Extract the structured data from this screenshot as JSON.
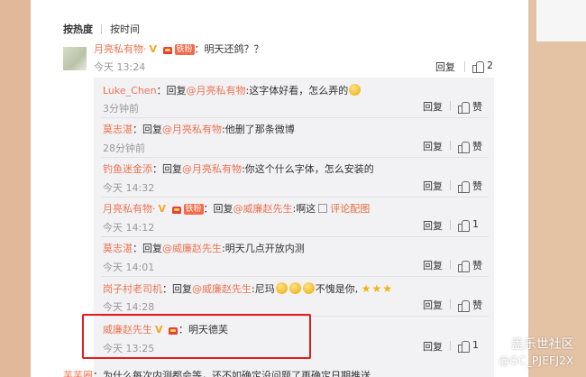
{
  "tabs": {
    "hot": "按热度",
    "time": "按时间"
  },
  "main": {
    "username": "月亮私有物·",
    "fan_badge": "铁粉",
    "separator": "：",
    "text": "明天还鸽？？",
    "time": "今天 13:24",
    "reply_label": "回复",
    "like_count": "2"
  },
  "replies": [
    {
      "user": "Luke_Chen",
      "prefix": "：回复",
      "target": "@月亮私有物",
      "text": ":这字体好看，怎么弄的",
      "time": "3分钟前",
      "reply": "回复",
      "like": "赞"
    },
    {
      "user": "莫志湛",
      "prefix": "：回复",
      "target": "@月亮私有物",
      "text": ":他删了那条微博",
      "time": "28分钟前",
      "reply": "回复",
      "like": "赞"
    },
    {
      "user": "钓鱼迷金添",
      "prefix": "：回复",
      "target": "@月亮私有物",
      "text": ":你这个什么字体，怎么安装的",
      "time": "今天 14:32",
      "reply": "回复",
      "like": "赞"
    },
    {
      "user": "月亮私有物·",
      "prefix": "：回复",
      "target": "@威廉赵先生",
      "text": ":啊这",
      "extra": "评论配图",
      "time": "今天 14:12",
      "reply": "回复",
      "like": "1"
    },
    {
      "user": "莫志湛",
      "prefix": "：回复",
      "target": "@威廉赵先生",
      "text": ":明天几点开放内测",
      "time": "今天 14:01",
      "reply": "回复",
      "like": "赞"
    },
    {
      "user": "岗子村老司机",
      "prefix": "：回复",
      "target": "@威廉赵先生",
      "text": ":尼玛",
      "text2": "不愧是你,",
      "time": "今天 14:28",
      "reply": "回复",
      "like": "赞"
    },
    {
      "user": "威廉赵先生",
      "prefix": "：",
      "target": "",
      "text": "明天德芙",
      "time": "今天 13:25",
      "reply": "回复",
      "like": "1"
    }
  ],
  "bottom": {
    "user": "芙芙圈",
    "text": "：为什么每次内测都会等，还不如确定没问题了再确定日期推送"
  },
  "watermark": {
    "line1": "盖乐世社区",
    "line2": "@GC_PJEFJ2X"
  },
  "colors": {
    "accent": "#eb7350",
    "highlight": "#e11d1d",
    "reply_bg": "#f2f2f5"
  }
}
